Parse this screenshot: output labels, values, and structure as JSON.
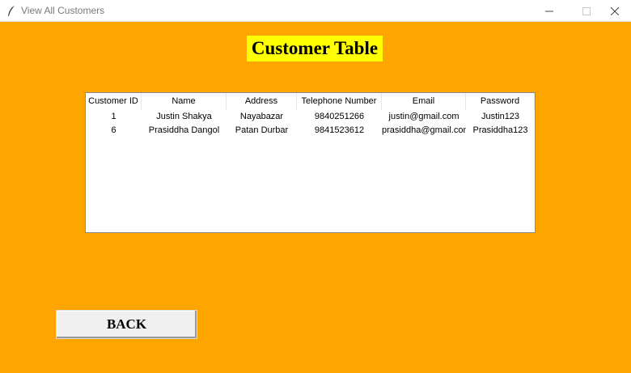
{
  "window": {
    "title": "View All Customers"
  },
  "heading": "Customer Table",
  "table": {
    "columns": [
      "Customer ID",
      "Name",
      "Address",
      "Telephone Number",
      "Email",
      "Password"
    ],
    "rows": [
      [
        "1",
        "Justin Shakya",
        "Nayabazar",
        "9840251266",
        "justin@gmail.com",
        "Justin123"
      ],
      [
        "6",
        "Prasiddha Dangol",
        "Patan Durbar",
        "9841523612",
        "prasiddha@gmail.com",
        "Prasiddha123"
      ]
    ]
  },
  "back_button": "BACK",
  "colors": {
    "background": "#FFA500",
    "heading_background": "#FFFF00"
  }
}
